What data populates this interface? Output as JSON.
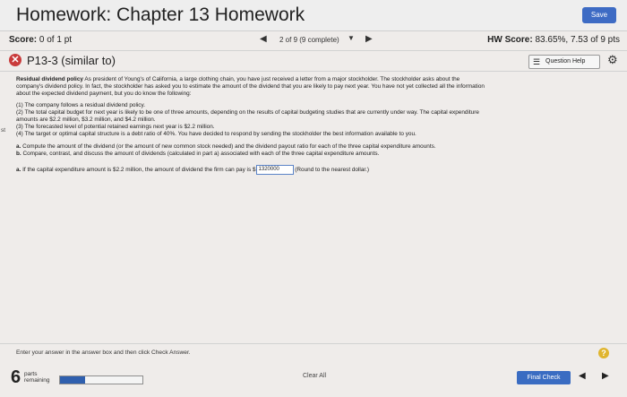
{
  "header": {
    "title": "Homework: Chapter 13 Homework",
    "save_label": "Save"
  },
  "scorebar": {
    "score_label": "Score:",
    "score_value": "0 of 1 pt",
    "position_text": "2 of 9 (9 complete)",
    "hw_label": "HW Score:",
    "hw_value": "83.65%, 7.53 of 9 pts"
  },
  "problem": {
    "title": "P13-3 (similar to)",
    "help_label": "Question Help"
  },
  "content": {
    "intro_bold": "Residual dividend policy",
    "intro_line1": " As president of Young's of California, a large clothing chain, you have just received a letter from a major stockholder. The stockholder asks about the",
    "intro_line2": "company's dividend policy. In fact, the stockholder has asked you to estimate the amount of the dividend that you are likely to pay next year. You have not yet collected all the information",
    "intro_line3": "about the expected dividend payment, but you do know the following:",
    "items": [
      "(1) The company follows a residual dividend policy.",
      "(2) The total capital budget for next year is likely to be one of three amounts, depending on the results of capital budgeting studies that are currently under way. The capital expenditure",
      "amounts are $2.2 million, $3.2 million, and $4.2 million.",
      "(3) The forecasted level of potential retained earnings next year is $2.2 million.",
      "(4) The target or optimal capital structure is a debt ratio of 40%. You have decided to respond by sending the stockholder the best information available to you."
    ],
    "task_a_letter": "a.",
    "task_a": " Compute the amount of the dividend (or the amount of new common stock needed) and the dividend payout ratio for each of the three capital expenditure amounts.",
    "task_b_letter": "b.",
    "task_b": " Compare, contrast, and discuss the amount of dividends (calculated in part a) associated with each of the three capital expenditure amounts.",
    "answer_letter": "a.",
    "answer_prefix": " If the capital expenditure amount is $2.2 million, the amount of dividend the firm can pay is $",
    "answer_value": "1320000",
    "answer_suffix": " (Round to the nearest dollar.)",
    "side_mark": "st"
  },
  "footer": {
    "hint": "Enter your answer in the answer box and then click Check Answer.",
    "parts_num": "6",
    "parts_lbl1": "parts",
    "parts_lbl2": "remaining",
    "progress": 0.3,
    "clear_all": "Clear All",
    "final_check": "Final Check"
  }
}
